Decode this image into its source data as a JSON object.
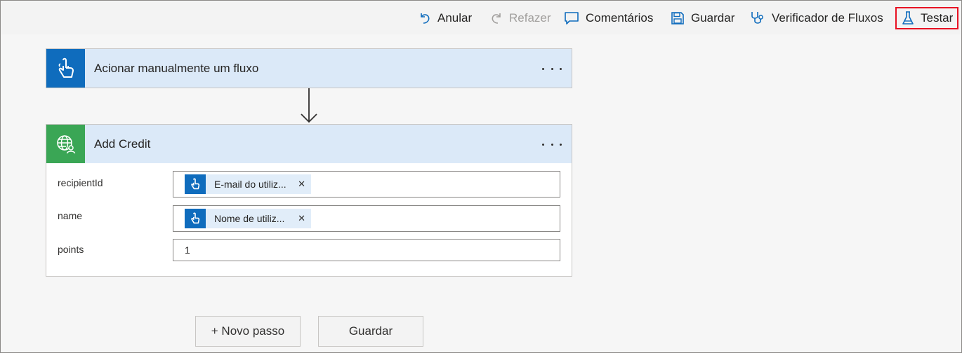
{
  "toolbar": {
    "undo_label": "Anular",
    "redo_label": "Refazer",
    "comments_label": "Comentários",
    "save_label": "Guardar",
    "checker_label": "Verificador de Fluxos",
    "test_label": "Testar"
  },
  "trigger_card": {
    "title": "Acionar manualmente um fluxo",
    "icon": "touch-hand-icon",
    "color": "#0f6cbd"
  },
  "action_card": {
    "title": "Add Credit",
    "icon": "globe-user-icon",
    "color": "#3aa655",
    "fields": [
      {
        "label": "recipientId",
        "token": "E-mail do utiliz..."
      },
      {
        "label": "name",
        "token": "Nome de utiliz..."
      },
      {
        "label": "points",
        "value": "1"
      }
    ]
  },
  "buttons": {
    "new_step": "+ Novo passo",
    "save": "Guardar"
  },
  "colors": {
    "accent": "#0f6cbd",
    "header_bg": "#dbe9f8",
    "highlight_border": "#e81123"
  }
}
